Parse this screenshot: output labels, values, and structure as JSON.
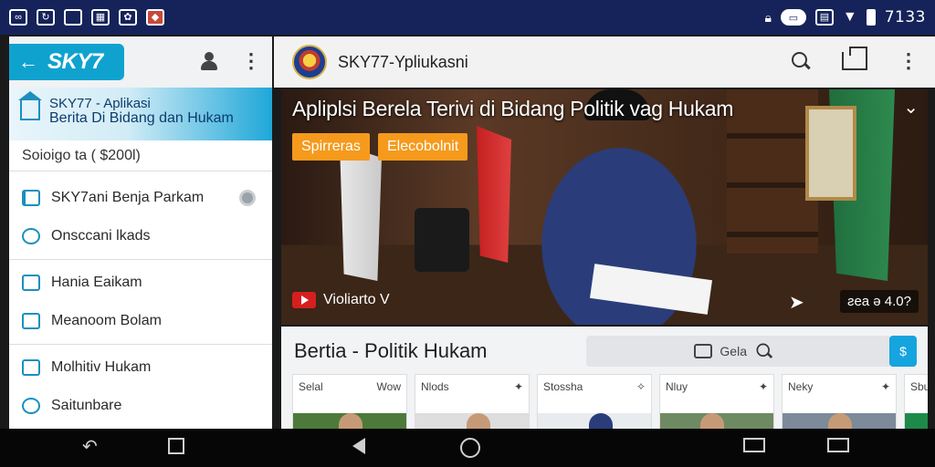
{
  "status_bar": {
    "time": "7133",
    "left_icons": [
      "link-icon",
      "refresh-icon",
      "square-icon",
      "gallery-icon",
      "game-icon",
      "shield-icon"
    ],
    "right_icons": [
      "lock-icon",
      "cast-icon",
      "screenshot-icon",
      "wifi-icon",
      "battery-icon"
    ]
  },
  "drawer": {
    "brand": "SKY7",
    "banner_line1": "SKY77 - Aplikasi",
    "banner_line2": "Berita  Di Bidang dan Hukam",
    "banner_sub": "Soioigo ta  ( $200l)",
    "items": [
      {
        "label": "SKY7ani Benja Parkam",
        "icon": "bookmark-icon"
      },
      {
        "label": "Onsccani lkads",
        "icon": "refresh-circle-icon"
      },
      {
        "label": "Hania Eaikam",
        "icon": "chart-icon"
      },
      {
        "label": "Meanoom Bolam",
        "icon": "pulse-icon"
      },
      {
        "label": "Molhitiv Hukam",
        "icon": "minus-box-icon"
      },
      {
        "label": "Saitunbare",
        "icon": "drop-icon"
      }
    ]
  },
  "appbar": {
    "title": "SKY77-Ypliukasni"
  },
  "hero": {
    "title": "Apliplsi Berela Terivi di Bidang Politik vag Hukam",
    "tag1": "Spirreras",
    "tag2": "Elecobolnit",
    "source": "Violiarto V",
    "stats": "ƨeа  ǝ  4.0?"
  },
  "news": {
    "heading": "Bertia - Politik Hukam",
    "search_label": "Gela",
    "filter_label": "$",
    "cards": [
      {
        "left": "Selal",
        "right": "Wow"
      },
      {
        "left": "Nlods",
        "right": "✦"
      },
      {
        "left": "Stossha",
        "right": "✧"
      },
      {
        "left": "Nluy",
        "right": "✦"
      },
      {
        "left": "Neky",
        "right": "✦"
      },
      {
        "left": "Sbu",
        "right": ""
      }
    ]
  },
  "colors": {
    "status_bar": "#15235a",
    "accent": "#10a2cf",
    "tag": "#f59a1c",
    "nav_bar": "#060606"
  }
}
